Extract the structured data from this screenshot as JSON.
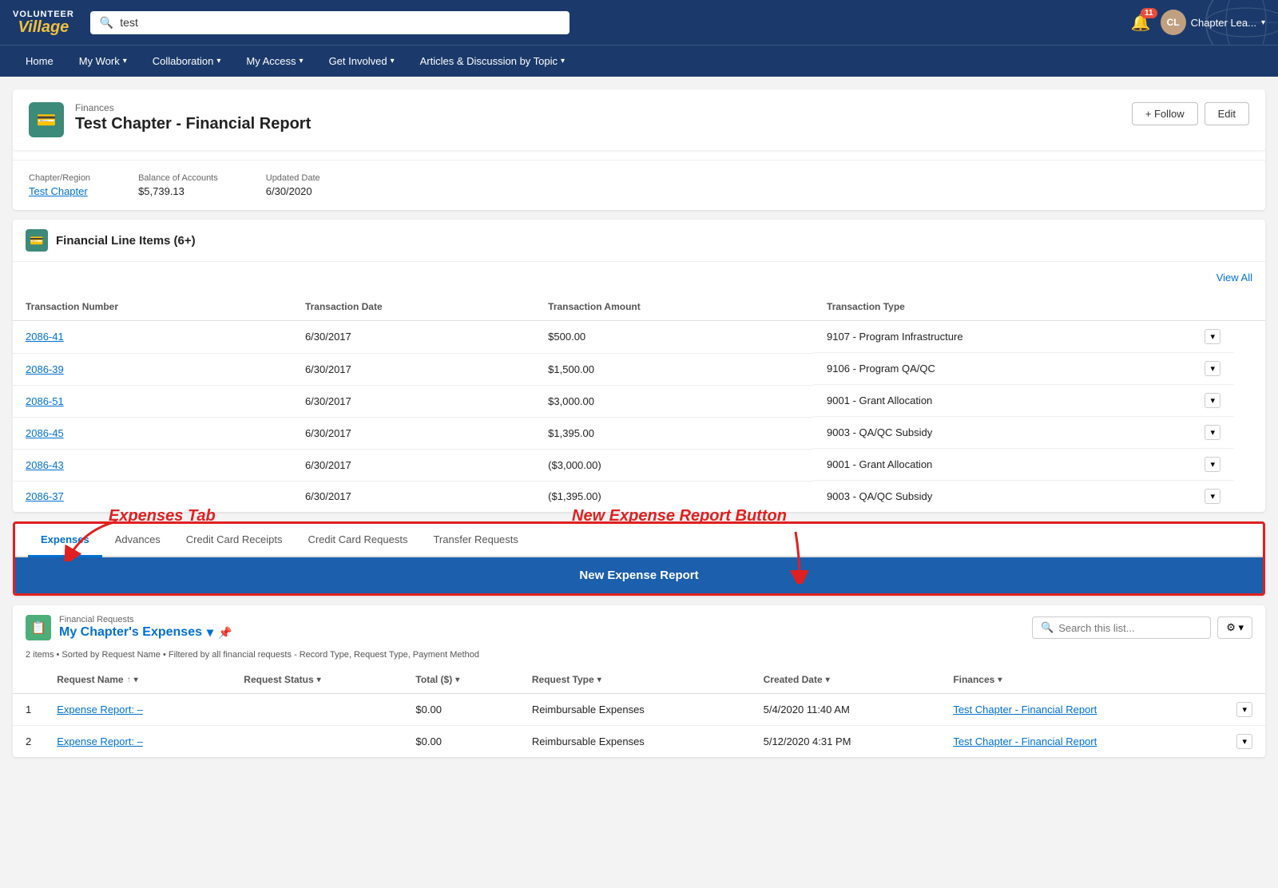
{
  "nav": {
    "logo": {
      "volunteer": "VOLUNTEER",
      "village": "Village"
    },
    "search_placeholder": "test",
    "bell_count": "11",
    "user_label": "Chapter Lea...",
    "items": [
      {
        "label": "Home"
      },
      {
        "label": "My Work",
        "has_dropdown": true
      },
      {
        "label": "Collaboration",
        "has_dropdown": true
      },
      {
        "label": "My Access",
        "has_dropdown": true
      },
      {
        "label": "Get Involved",
        "has_dropdown": true
      },
      {
        "label": "Articles & Discussion by Topic",
        "has_dropdown": true
      }
    ]
  },
  "record": {
    "breadcrumb": "Finances",
    "title": "Test Chapter - Financial Report",
    "icon": "💳",
    "actions": {
      "follow": "+ Follow",
      "edit": "Edit"
    },
    "fields": [
      {
        "label": "Chapter/Region",
        "value": "Test Chapter",
        "is_link": true
      },
      {
        "label": "Balance of Accounts",
        "value": "$5,739.13"
      },
      {
        "label": "Updated Date",
        "value": "6/30/2020"
      }
    ]
  },
  "financial_line_items": {
    "title": "Financial Line Items (6+)",
    "icon": "💳",
    "columns": [
      "Transaction Number",
      "Transaction Date",
      "Transaction Amount",
      "Transaction Type"
    ],
    "rows": [
      {
        "number": "2086-41",
        "date": "6/30/2017",
        "amount": "$500.00",
        "type": "9107 - Program Infrastructure"
      },
      {
        "number": "2086-39",
        "date": "6/30/2017",
        "amount": "$1,500.00",
        "type": "9106 - Program QA/QC"
      },
      {
        "number": "2086-51",
        "date": "6/30/2017",
        "amount": "$3,000.00",
        "type": "9001 - Grant Allocation"
      },
      {
        "number": "2086-45",
        "date": "6/30/2017",
        "amount": "$1,395.00",
        "type": "9003 - QA/QC Subsidy"
      },
      {
        "number": "2086-43",
        "date": "6/30/2017",
        "amount": "($3,000.00)",
        "type": "9001 - Grant Allocation"
      },
      {
        "number": "2086-37",
        "date": "6/30/2017",
        "amount": "($1,395.00)",
        "type": "9003 - QA/QC Subsidy"
      }
    ],
    "view_all": "View All"
  },
  "tabs": {
    "items": [
      {
        "label": "Expenses",
        "active": true
      },
      {
        "label": "Advances"
      },
      {
        "label": "Credit Card Receipts"
      },
      {
        "label": "Credit Card Requests"
      },
      {
        "label": "Transfer Requests"
      }
    ],
    "new_button": "New Expense Report"
  },
  "annotations": {
    "expenses_tab": "Expenses Tab",
    "new_button": "New Expense Report Button"
  },
  "financial_requests": {
    "breadcrumb": "Financial Requests",
    "title": "My Chapter's Expenses",
    "icon": "📋",
    "meta": "2 items • Sorted by Request Name • Filtered by all financial requests - Record Type, Request Type, Payment Method",
    "search_placeholder": "Search this list...",
    "columns": [
      {
        "label": "Request Name",
        "sortable": true
      },
      {
        "label": "Request Status",
        "sortable": true
      },
      {
        "label": "Total ($)",
        "sortable": true
      },
      {
        "label": "Request Type",
        "sortable": true
      },
      {
        "label": "Created Date",
        "sortable": true
      },
      {
        "label": "Finances",
        "sortable": true
      }
    ],
    "rows": [
      {
        "num": "1",
        "request_name": "Expense Report: –",
        "request_status": "",
        "total": "$0.00",
        "request_type": "Reimbursable Expenses",
        "created_date": "5/4/2020 11:40 AM",
        "finances": "Test Chapter - Financial Report"
      },
      {
        "num": "2",
        "request_name": "Expense Report: –",
        "request_status": "",
        "total": "$0.00",
        "request_type": "Reimbursable Expenses",
        "created_date": "5/12/2020 4:31 PM",
        "finances": "Test Chapter - Financial Report"
      }
    ]
  }
}
